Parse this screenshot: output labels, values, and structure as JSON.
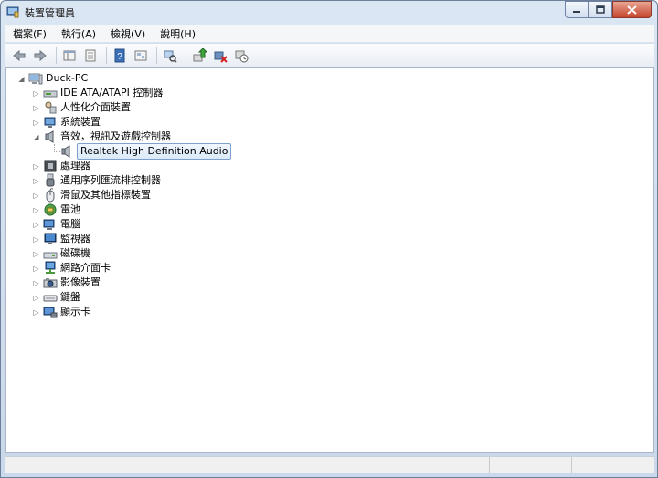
{
  "window": {
    "title": "裝置管理員"
  },
  "menu": [
    {
      "label": "檔案(F)"
    },
    {
      "label": "執行(A)"
    },
    {
      "label": "檢視(V)"
    },
    {
      "label": "說明(H)"
    }
  ],
  "toolbar": {
    "buttons": [
      "back-icon",
      "forward-icon",
      "properties-pane-icon",
      "details-icon",
      "help-icon",
      "show-hidden-icon",
      "scan-hardware-icon",
      "update-driver-icon",
      "uninstall-icon",
      "disable-icon"
    ]
  },
  "tree": {
    "root": {
      "label": "Duck-PC",
      "expanded": true
    },
    "categories": [
      {
        "label": "IDE ATA/ATAPI 控制器",
        "icon": "ide-controller-icon",
        "expanded": false
      },
      {
        "label": "人性化介面裝置",
        "icon": "hid-icon",
        "expanded": false
      },
      {
        "label": "系統裝置",
        "icon": "system-device-icon",
        "expanded": false
      },
      {
        "label": "音效，視訊及遊戲控制器",
        "icon": "speaker-icon",
        "expanded": true,
        "children": [
          {
            "label": "Realtek High Definition Audio",
            "icon": "speaker-icon",
            "selected": true
          }
        ]
      },
      {
        "label": "處理器",
        "icon": "processor-icon",
        "expanded": false
      },
      {
        "label": "通用序列匯流排控制器",
        "icon": "usb-icon",
        "expanded": false
      },
      {
        "label": "滑鼠及其他指標裝置",
        "icon": "mouse-icon",
        "expanded": false
      },
      {
        "label": "電池",
        "icon": "battery-icon",
        "expanded": false
      },
      {
        "label": "電腦",
        "icon": "computer-icon",
        "expanded": false
      },
      {
        "label": "監視器",
        "icon": "monitor-icon",
        "expanded": false
      },
      {
        "label": "磁碟機",
        "icon": "disk-drive-icon",
        "expanded": false
      },
      {
        "label": "網路介面卡",
        "icon": "network-adapter-icon",
        "expanded": false
      },
      {
        "label": "影像裝置",
        "icon": "imaging-device-icon",
        "expanded": false
      },
      {
        "label": "鍵盤",
        "icon": "keyboard-icon",
        "expanded": false
      },
      {
        "label": "顯示卡",
        "icon": "display-adapter-icon",
        "expanded": false
      }
    ]
  },
  "colors": {
    "selection_border": "#7da2ce",
    "selection_fill": "#dbeaf9",
    "frame": "#c9d8ea"
  }
}
